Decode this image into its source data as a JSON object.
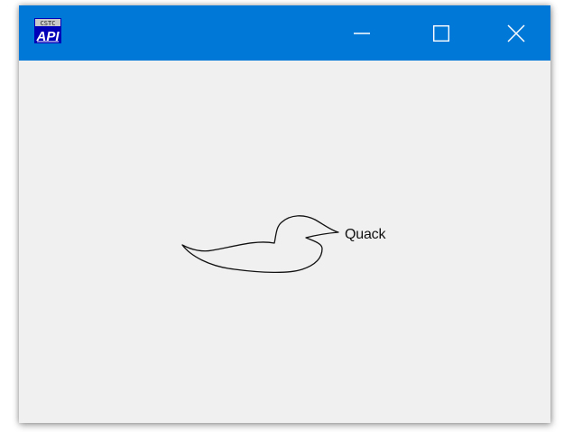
{
  "window": {
    "background": "#f0f0f0",
    "titlebar_color": "#0078d7",
    "app_icon": {
      "name": "api-app-icon",
      "top_text": "CSTC",
      "text": "API"
    },
    "controls": {
      "minimize_icon": "minimize-icon",
      "maximize_icon": "maximize-icon",
      "close_icon": "close-icon"
    }
  },
  "canvas": {
    "drawing": "duck-outline",
    "label": "Quack"
  }
}
